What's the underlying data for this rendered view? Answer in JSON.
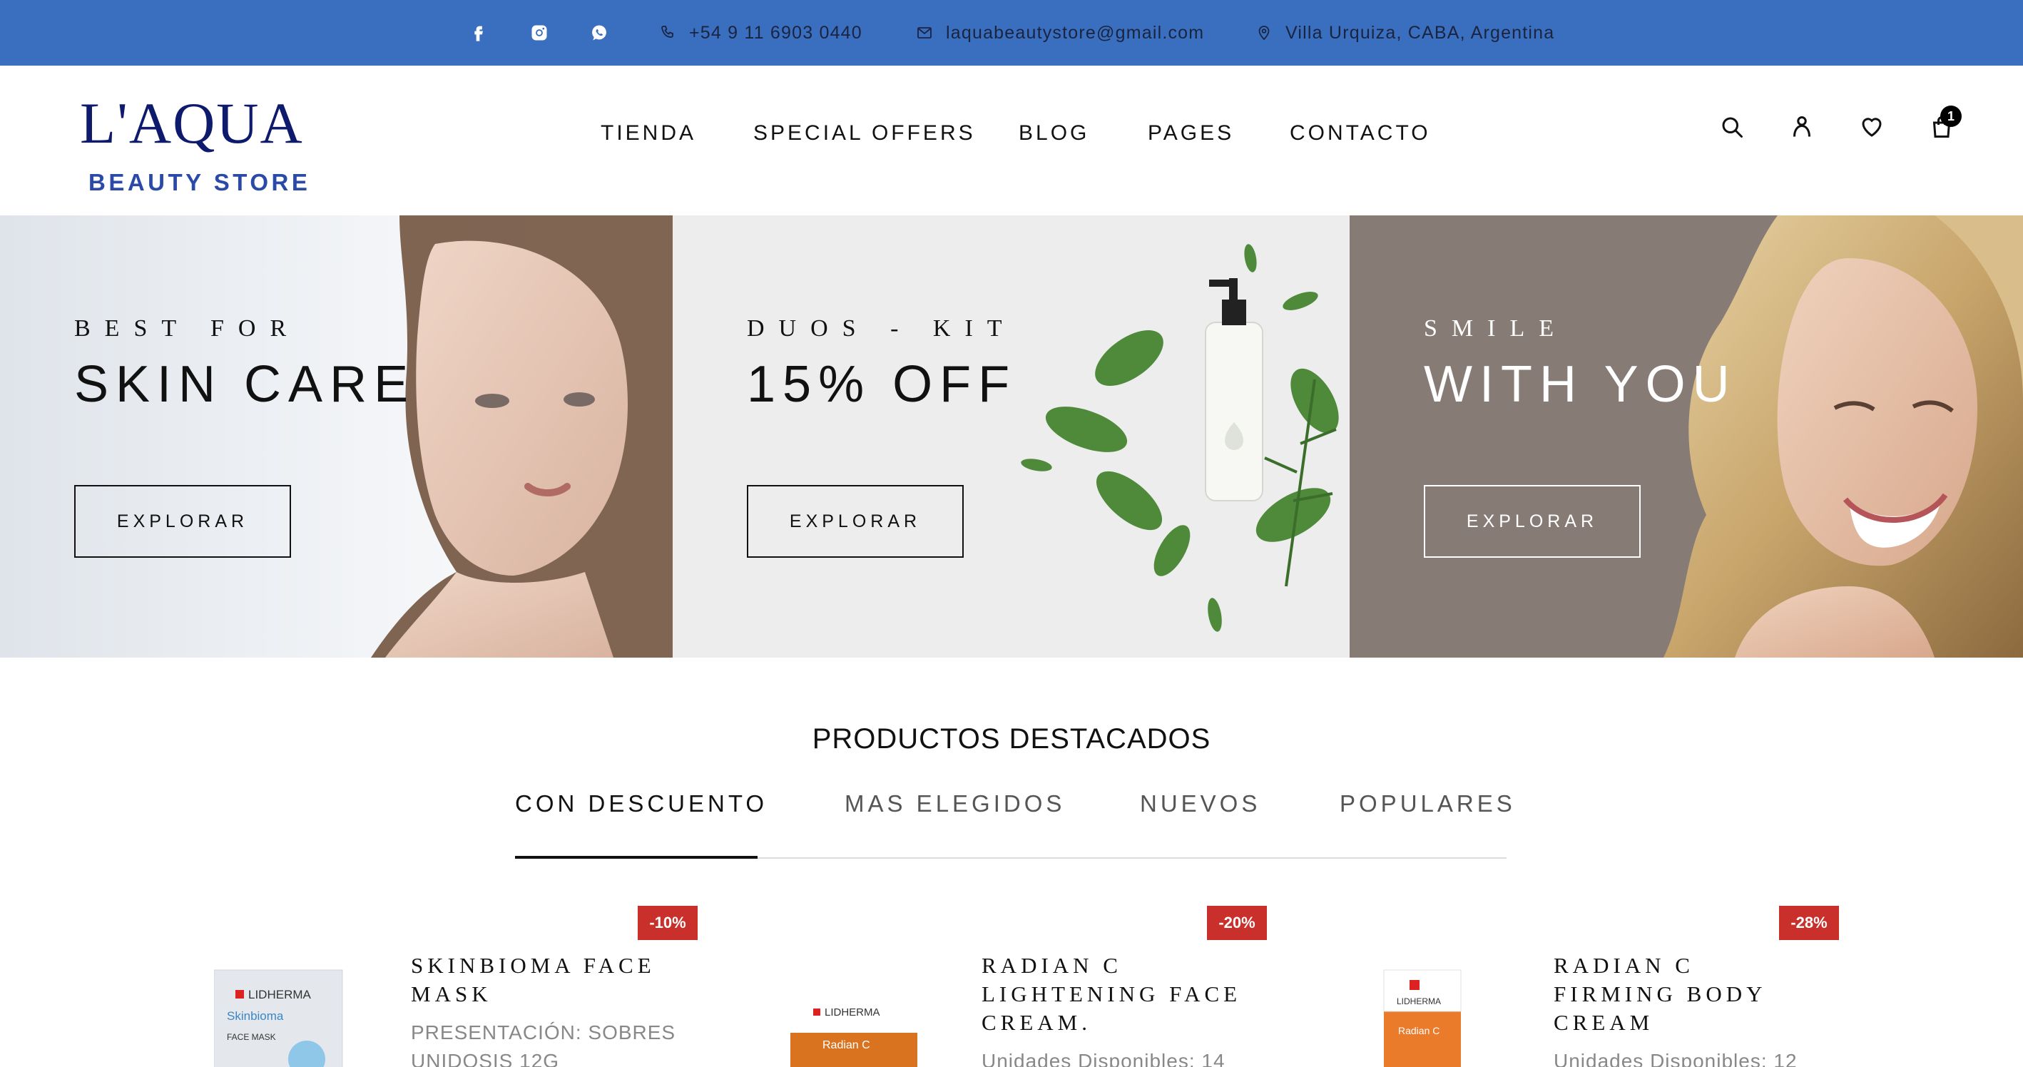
{
  "topbar": {
    "social": [
      "facebook-icon",
      "instagram-icon",
      "whatsapp-icon"
    ],
    "phone": "+54 9 11 6903 0440",
    "email": "laquabeautystore@gmail.com",
    "location": "Villa Urquiza, CABA, Argentina"
  },
  "logo": {
    "main": "L'AQUA",
    "sub": "BEAUTY STORE"
  },
  "nav": [
    "TIENDA",
    "SPECIAL OFFERS",
    "BLOG",
    "PAGES",
    "CONTACTO"
  ],
  "header_icons": [
    "search-icon",
    "user-icon",
    "heart-icon",
    "cart-icon"
  ],
  "cart_count": "1",
  "banners": [
    {
      "small": "BEST FOR",
      "big": "SKIN CARE",
      "button": "EXPLORAR"
    },
    {
      "small": "DUOS - KIT",
      "big": "15% OFF",
      "button": "EXPLORAR"
    },
    {
      "small": "SMILE",
      "big": "WITH YOU",
      "button": "EXPLORAR"
    }
  ],
  "featured": {
    "title": "PRODUCTOS DESTACADOS",
    "tabs": [
      "CON DESCUENTO",
      "MAS ELEGIDOS",
      "NUEVOS",
      "POPULARES"
    ],
    "active_tab": "CON DESCUENTO"
  },
  "products": [
    {
      "badge": "-10%",
      "name_lines": [
        "SKINBIOMA FACE",
        "MASK"
      ],
      "desc": "PRESENTACIÓN: SOBRES UNIDOSIS 12G",
      "pack_brand": "LIDHERMA",
      "pack_name": "Skinbioma",
      "pack_type": "FACE MASK"
    },
    {
      "badge": "-20%",
      "name_lines": [
        "RADIAN C",
        "LIGHTENING FACE",
        "CREAM."
      ],
      "desc": "Unidades Disponibles: 14",
      "pack_brand": "LIDHERMA",
      "pack_name": "Radian C",
      "pack_type": ""
    },
    {
      "badge": "-28%",
      "name_lines": [
        "RADIAN C",
        "FIRMING BODY",
        "CREAM"
      ],
      "desc": "Unidades Disponibles: 12",
      "pack_brand": "LIDHERMA",
      "pack_name": "Radian C",
      "pack_type": ""
    }
  ],
  "colors": {
    "topbar": "#3a6fbf",
    "logo": "#0e1a6b",
    "badge": "#c9302c"
  }
}
